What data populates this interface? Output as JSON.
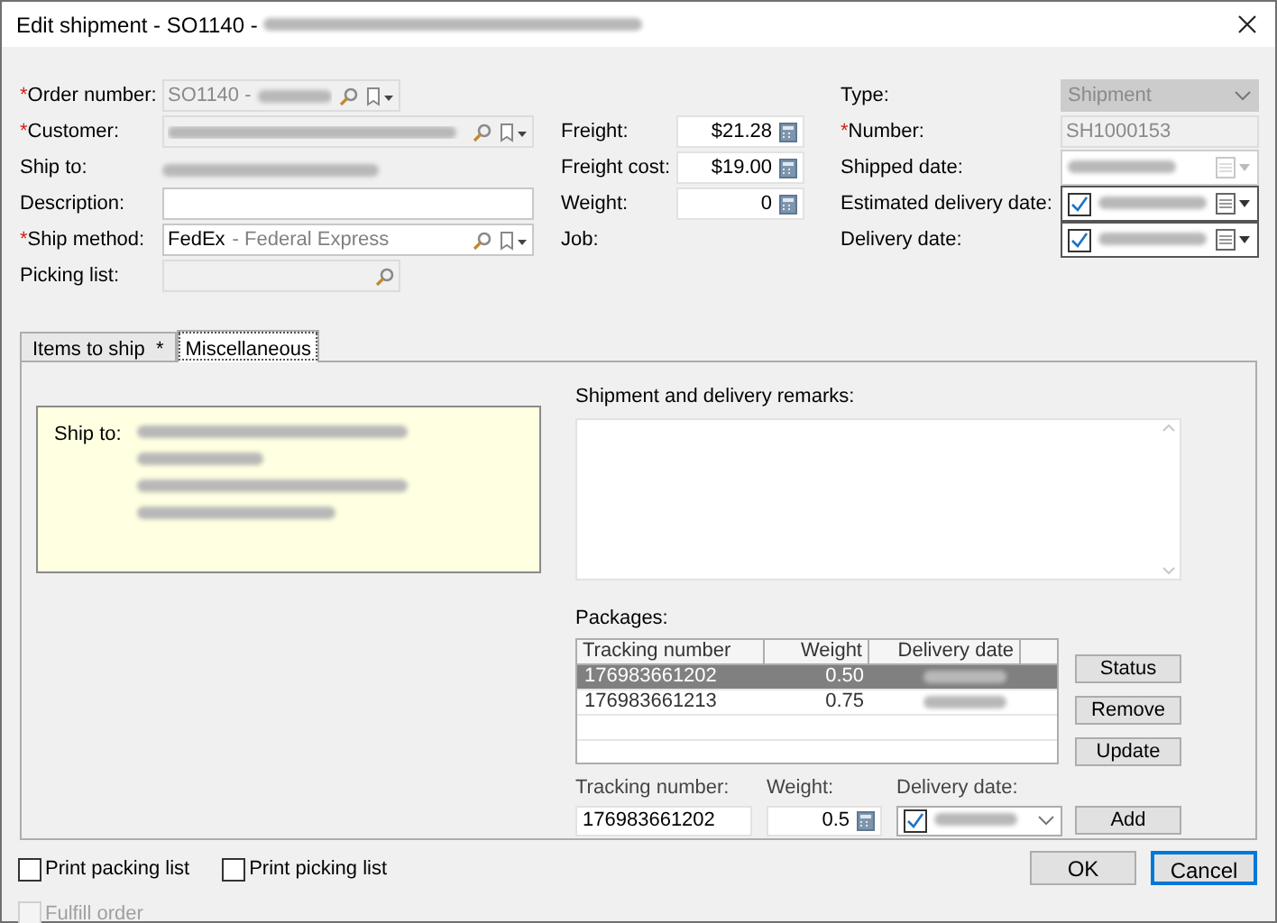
{
  "window": {
    "title": "Edit shipment - SO1140 - ",
    "title_redacted": true
  },
  "left_fields": [
    {
      "mark": "*",
      "label": "Order number:",
      "kind": "lookup",
      "value": "SO1140 -",
      "redacted": true,
      "disabled": true,
      "menu": true
    },
    {
      "mark": "*",
      "label": "Customer:",
      "kind": "lookup",
      "redacted": true,
      "disabled": true,
      "menu": true
    },
    {
      "label": "Ship to:",
      "kind": "static",
      "redacted": true
    },
    {
      "label": "Description:",
      "kind": "text",
      "disabled": false
    },
    {
      "mark": "*",
      "label": "Ship method:",
      "kind": "lookup",
      "value": "FedEx",
      "detail": "- Federal Express",
      "disabled": false,
      "menu": true
    },
    {
      "label": "Picking list:",
      "kind": "lookup",
      "disabled": true,
      "menu": false
    }
  ],
  "middle_fields": [
    {
      "label": "Freight:",
      "kind": "number",
      "value": "$21.28"
    },
    {
      "label": "Freight cost:",
      "kind": "number",
      "value": "$19.00"
    },
    {
      "label": "Weight:",
      "kind": "number",
      "value": "0"
    },
    {
      "label": "Job:",
      "kind": "static"
    }
  ],
  "right_fields": [
    {
      "label": "Type:",
      "kind": "select",
      "value": "Shipment",
      "disabled": true
    },
    {
      "mark": "*",
      "label": "Number:",
      "kind": "text",
      "value": "SH1000153",
      "disabled": true
    },
    {
      "label": "Shipped date:",
      "kind": "date",
      "redacted": true,
      "disabled": true
    },
    {
      "label": "Estimated delivery date:",
      "kind": "date",
      "redacted": true,
      "disabled": false,
      "checked": true
    },
    {
      "label": "Delivery date:",
      "kind": "date",
      "redacted": true,
      "disabled": false,
      "checked": true
    }
  ],
  "tabs": [
    {
      "label": "Items to ship  *",
      "selected": false
    },
    {
      "label": "Miscellaneous",
      "selected": true
    }
  ],
  "ship_to_box": {
    "label": "Ship to:",
    "lines": [
      {
        "redacted": true
      },
      {
        "redacted": true
      },
      {
        "redacted": true
      },
      {
        "redacted": true
      }
    ]
  },
  "remarks": {
    "label": "Shipment and delivery remarks:"
  },
  "packages": {
    "label": "Packages:",
    "columns": [
      "Tracking number",
      "Weight",
      "Delivery date"
    ],
    "rows": [
      {
        "tracking": "176983661202",
        "weight": "0.50",
        "date_redacted": true,
        "selected": true
      },
      {
        "tracking": "176983661213",
        "weight": "0.75",
        "date_redacted": true,
        "selected": false
      }
    ],
    "side_buttons": [
      "Status",
      "Remove",
      "Update"
    ],
    "editor": {
      "tracking_label": "Tracking number:",
      "tracking": "176983661202",
      "weight_label": "Weight:",
      "weight": "0.5",
      "date_label": "Delivery date:",
      "date_checked": true,
      "date_redacted": true,
      "add": "Add"
    }
  },
  "options": [
    {
      "label": "Print packing list",
      "checked": false,
      "disabled": false
    },
    {
      "label": "Print picking list",
      "checked": false,
      "disabled": false
    },
    {
      "label": "Fulfill order",
      "checked": false,
      "disabled": true
    }
  ],
  "buttons": [
    {
      "label": "OK",
      "default": false
    },
    {
      "label": "Cancel",
      "default": true
    }
  ]
}
